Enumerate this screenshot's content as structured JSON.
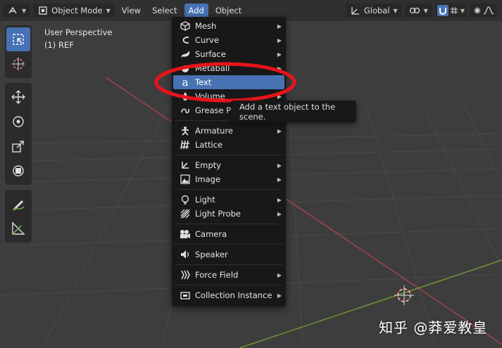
{
  "header": {
    "editor_type_icon": "axis-view-icon",
    "mode": "Object Mode",
    "menus": [
      "View",
      "Select",
      "Add",
      "Object"
    ],
    "transform_orientation": "Global",
    "colors": {
      "bar": "#303030",
      "active": "#4772b3"
    }
  },
  "toolbar": {
    "tools": [
      "select-box-icon",
      "cursor-icon",
      "move-icon",
      "rotate-icon",
      "scale-icon",
      "transform-icon",
      "annotate-icon",
      "measure-icon"
    ],
    "active_tool": "select-box-icon"
  },
  "viewport": {
    "view_name": "User Perspective",
    "collection": "(1) REF",
    "axis_colors": {
      "x": "#c14c58",
      "y": "#7ba03a"
    }
  },
  "add_menu": {
    "items": [
      {
        "label": "Mesh",
        "icon": "mesh-icon",
        "submenu": true
      },
      {
        "label": "Curve",
        "icon": "curve-icon",
        "submenu": true
      },
      {
        "label": "Surface",
        "icon": "surface-icon",
        "submenu": true
      },
      {
        "label": "Metaball",
        "icon": "metaball-icon",
        "submenu": true
      },
      {
        "label": "Text",
        "icon": "text-icon",
        "submenu": false,
        "highlighted": true
      },
      {
        "label": "Volume",
        "icon": "volume-icon",
        "submenu": true
      },
      {
        "label": "Grease Pencil",
        "icon": "grease-pencil-icon",
        "submenu": true
      },
      {
        "label": "Armature",
        "icon": "armature-icon",
        "submenu": true
      },
      {
        "label": "Lattice",
        "icon": "lattice-icon",
        "submenu": false
      },
      {
        "label": "Empty",
        "icon": "empty-icon",
        "submenu": true
      },
      {
        "label": "Image",
        "icon": "image-icon",
        "submenu": true
      },
      {
        "label": "Light",
        "icon": "light-icon",
        "submenu": true
      },
      {
        "label": "Light Probe",
        "icon": "light-probe-icon",
        "submenu": true
      },
      {
        "label": "Camera",
        "icon": "camera-icon",
        "submenu": false
      },
      {
        "label": "Speaker",
        "icon": "speaker-icon",
        "submenu": false
      },
      {
        "label": "Force Field",
        "icon": "force-field-icon",
        "submenu": true
      },
      {
        "label": "Collection Instance",
        "icon": "collection-instance-icon",
        "submenu": true
      }
    ]
  },
  "tooltip": {
    "text": "Add a text object to the scene."
  },
  "annotation": {
    "color": "#e8141b"
  },
  "watermark": "知乎 @莽爱教皇"
}
